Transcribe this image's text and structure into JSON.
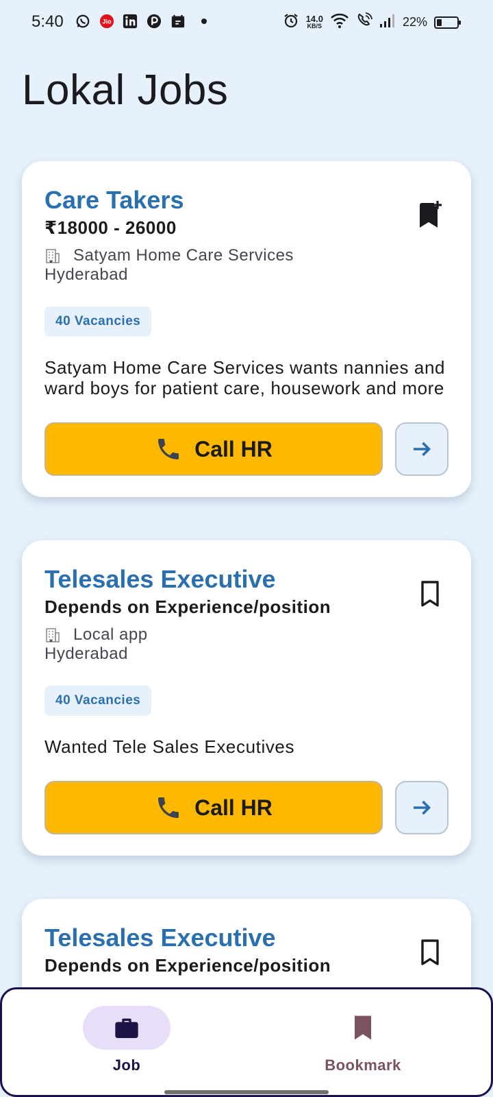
{
  "status_bar": {
    "time": "5:40",
    "notification_icons": [
      "whatsapp-icon",
      "jio-icon",
      "linkedin-icon",
      "app-icon",
      "app-icon",
      "dot-icon"
    ],
    "net_speed_value": "14.0",
    "net_speed_unit": "KB/S",
    "battery_percent": "22%"
  },
  "app": {
    "title": "Lokal Jobs"
  },
  "jobs": [
    {
      "title": "Care Takers",
      "salary": "₹18000 - 26000",
      "company": "Satyam Home Care Services",
      "city": "Hyderabad",
      "vacancies": "40 Vacancies",
      "description": "Satyam Home Care Services wants nannies and ward boys for patient care, housework and more",
      "bookmarked": false,
      "bookmark_icon": "bookmark-add-icon",
      "call_label": "Call HR"
    },
    {
      "title": "Telesales Executive",
      "salary": "Depends on Experience/position",
      "company": "Local app",
      "city": "Hyderabad",
      "vacancies": "40 Vacancies",
      "description": "Wanted Tele Sales Executives",
      "bookmarked": false,
      "bookmark_icon": "bookmark-outline-icon",
      "call_label": "Call HR"
    },
    {
      "title": "Telesales Executive",
      "salary": "Depends on Experience/position",
      "bookmark_icon": "bookmark-outline-icon"
    }
  ],
  "nav": {
    "items": [
      {
        "label": "Job",
        "icon": "briefcase-icon",
        "active": true
      },
      {
        "label": "Bookmark",
        "icon": "bookmark-icon",
        "active": false
      }
    ]
  },
  "colors": {
    "background": "#e6f1fc",
    "title_blue": "#2a6fb0",
    "call_button": "#ffb800",
    "nav_active_pill": "#e8def8",
    "nav_inactive": "#7d5260"
  }
}
